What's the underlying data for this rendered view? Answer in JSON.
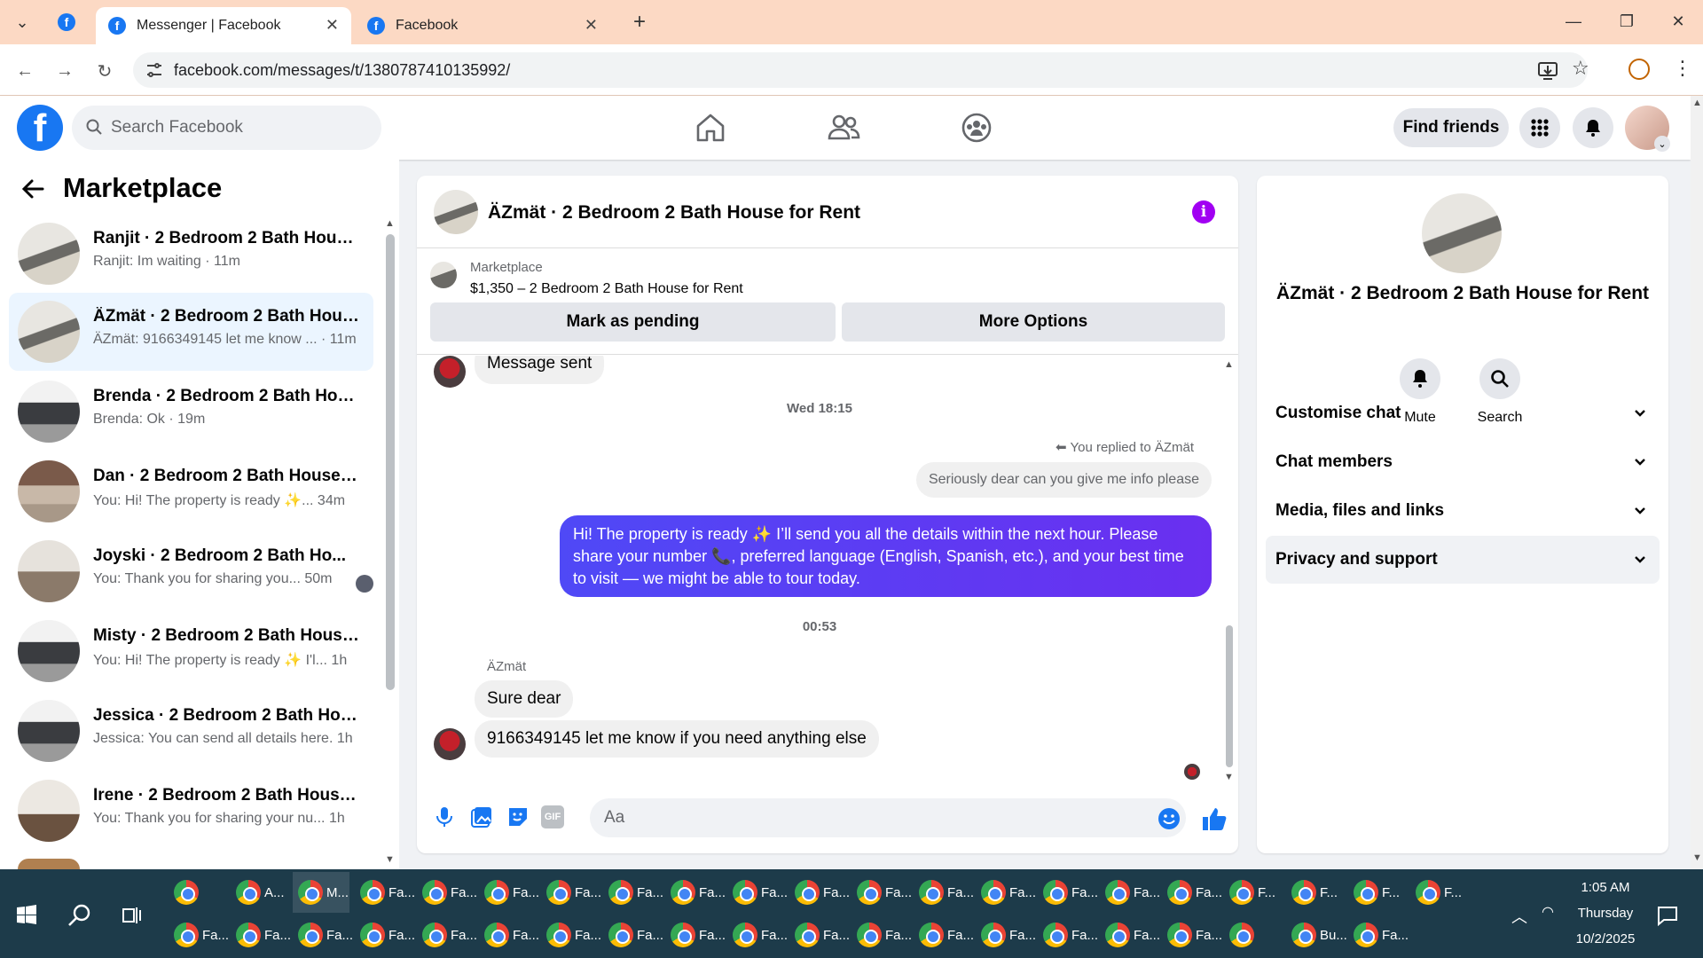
{
  "browser": {
    "tabs": [
      {
        "title": "Messenger | Facebook",
        "active": true
      },
      {
        "title": "Facebook",
        "active": false
      }
    ],
    "url": "facebook.com/messages/t/1380787410135992/"
  },
  "fb_header": {
    "search_placeholder": "Search Facebook",
    "find_friends": "Find friends"
  },
  "sidebar": {
    "title": "Marketplace",
    "conversations": [
      {
        "name": "Ranjit · 2 Bedroom 2 Bath Hous...",
        "preview": "Ranjit: Im waiting · 11m",
        "selected": false
      },
      {
        "name": "ÄZmät · 2 Bedroom 2 Bath Hous...",
        "preview": "ÄZmät: 9166349145 let me know ... · 11m",
        "selected": true
      },
      {
        "name": "Brenda · 2 Bedroom 2 Bath Hou...",
        "preview": "Brenda: Ok · 19m",
        "selected": false
      },
      {
        "name": "Dan · 2 Bedroom 2 Bath House f...",
        "preview": "You: Hi! The property is ready ✨... 34m",
        "selected": false
      },
      {
        "name": "Joyski · 2 Bedroom 2 Bath Ho...",
        "preview": "You: Thank you for sharing you... 50m",
        "selected": false
      },
      {
        "name": "Misty · 2 Bedroom 2 Bath House...",
        "preview": "You: Hi! The property is ready ✨ I'l... 1h",
        "selected": false
      },
      {
        "name": "Jessica · 2 Bedroom 2 Bath Hous...",
        "preview": "Jessica: You can send all details here. 1h",
        "selected": false
      },
      {
        "name": "Irene · 2 Bedroom 2 Bath House ...",
        "preview": "You: Thank you for sharing your nu... 1h",
        "selected": false
      }
    ]
  },
  "chat": {
    "title": "ÄZmät · 2 Bedroom 2 Bath House for Rent",
    "listing_source": "Marketplace",
    "listing_title": "$1,350 – 2 Bedroom 2 Bath House for Rent",
    "mark_pending": "Mark as pending",
    "more_options": "More Options",
    "msg_sent": "Message sent",
    "time1": "Wed 18:15",
    "replied_to": "You replied to ÄZmät",
    "quoted": "Seriously dear can you give me info please",
    "outgoing": "Hi! The property is ready ✨ I’ll send you all the details within the next hour. Please share your number 📞, preferred language (English, Spanish, etc.), and your best time to visit — we might be able to tour today.",
    "time2": "00:53",
    "sender": "ÄZmät",
    "in1": "Sure dear",
    "in2": "9166349145 let me know if you need anything else",
    "composer_placeholder": "Aa",
    "gif_label": "GIF"
  },
  "details": {
    "title": "ÄZmät · 2 Bedroom 2 Bath House for Rent",
    "mute": "Mute",
    "search": "Search",
    "sections": [
      "Customise chat",
      "Chat members",
      "Media, files and links",
      "Privacy and support"
    ]
  },
  "taskbar": {
    "row1": [
      "",
      "A...",
      "M...",
      "Fa...",
      "Fa...",
      "Fa...",
      "Fa...",
      "Fa...",
      "Fa...",
      "Fa...",
      "Fa...",
      "Fa...",
      "Fa...",
      "Fa...",
      "Fa...",
      "Fa...",
      "Fa...",
      "F...",
      "F...",
      "F...",
      "F..."
    ],
    "row2": [
      "Fa...",
      "Fa...",
      "Fa...",
      "Fa...",
      "Fa...",
      "Fa...",
      "Fa...",
      "Fa...",
      "Fa...",
      "Fa...",
      "Fa...",
      "Fa...",
      "Fa...",
      "Fa...",
      "Fa...",
      "Fa...",
      "Fa...",
      "",
      "Bu...",
      "Fa..."
    ],
    "time": "1:05 AM",
    "day": "Thursday",
    "date": "10/2/2025"
  },
  "colors": {
    "fb_blue": "#1877f2",
    "outgoing_bubble": "#5b3dfa",
    "info_purple": "#a100f2",
    "tabbar": "#fcd9c4"
  }
}
